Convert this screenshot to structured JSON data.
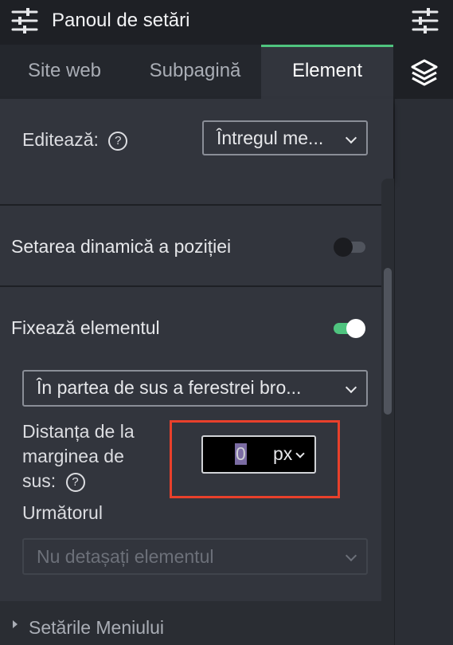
{
  "header": {
    "title": "Panoul de setări",
    "left_icon": "sliders-icon",
    "right_icon": "sliders-icon"
  },
  "tabs": [
    {
      "label": "Site web",
      "active": false
    },
    {
      "label": "Subpagină",
      "active": false
    },
    {
      "label": "Element",
      "active": true
    }
  ],
  "right_rail": {
    "icon": "layers-icon"
  },
  "edit": {
    "label": "Editează:",
    "help": "?",
    "select_value": "Întregul me..."
  },
  "dynamic_position": {
    "label": "Setarea dinamică a poziției",
    "enabled": false
  },
  "pin": {
    "label": "Fixează elementul",
    "enabled": true,
    "position_select": "În partea de sus a ferestrei bro...",
    "distance_label_lines": [
      "Distanța de la",
      "marginea de",
      "sus:"
    ],
    "distance_help": "?",
    "distance_value": "0",
    "distance_unit": "px",
    "next_label": "Următorul",
    "next_select": "Nu detașați elementul"
  },
  "menu_settings": {
    "label": "Setările Meniului"
  },
  "colors": {
    "accent": "#4fc47f",
    "highlight": "#e8402b",
    "panel": "#32353d",
    "topbar": "#1e2025"
  }
}
